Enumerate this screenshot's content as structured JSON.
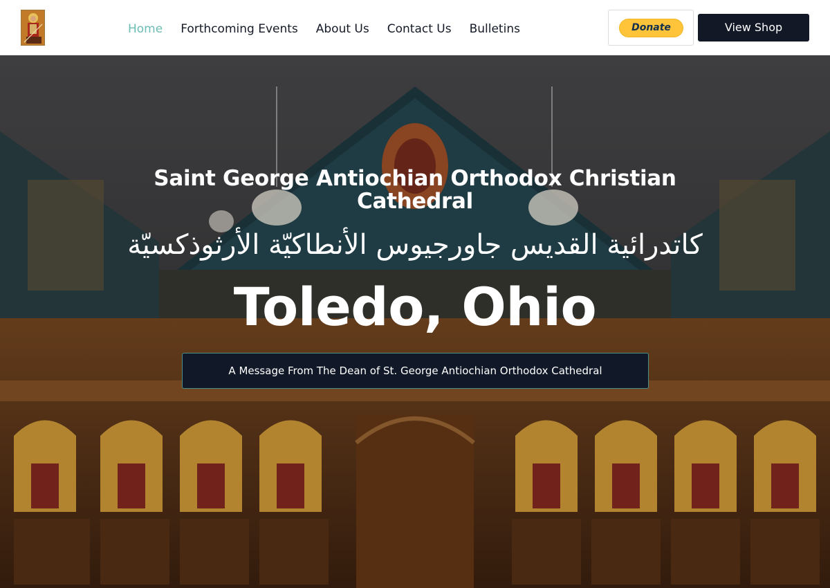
{
  "header": {
    "logo_icon": "st-george-icon",
    "nav": [
      {
        "label": "Home",
        "active": true
      },
      {
        "label": "Forthcoming Events",
        "active": false
      },
      {
        "label": "About Us",
        "active": false
      },
      {
        "label": "Contact Us",
        "active": false
      },
      {
        "label": "Bulletins",
        "active": false
      }
    ],
    "donate_label": "Donate",
    "shop_label": "View Shop"
  },
  "hero": {
    "title_en": "Saint George Antiochian Orthodox Christian Cathedral",
    "title_ar": "كاتدرائية القديس جاورجيوس الأنطاكيّة الأرثوذكسيّة",
    "city": "Toledo, Ohio",
    "message_button": "A Message From The Dean of St. George Antiochian Orthodox Cathedral"
  },
  "colors": {
    "nav_active": "#6cbdb4",
    "nav_text": "#141a26",
    "donate_bg": "#ffc439",
    "dark_button": "#121826"
  }
}
